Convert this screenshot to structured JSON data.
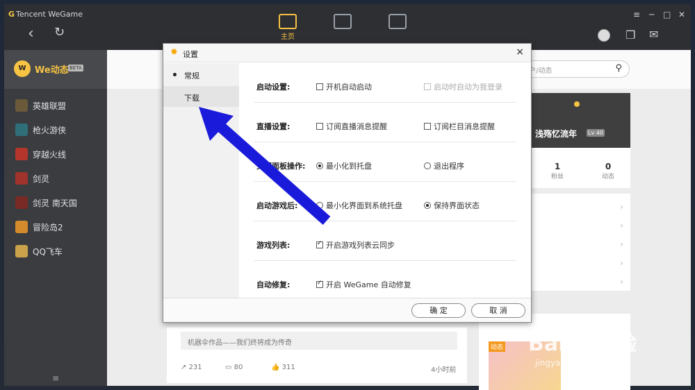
{
  "app": {
    "logo_brand": "G",
    "logo_text": "Tencent WeGame"
  },
  "topnav": {
    "home_label": "主页"
  },
  "sidebar": {
    "brand_icon": "W",
    "brand_name": "We动态",
    "brand_badge": "BETA",
    "games": [
      {
        "label": "英雄联盟",
        "color": "#6b5a3a"
      },
      {
        "label": "枪火游侠",
        "color": "#2f6f7a"
      },
      {
        "label": "穿越火线",
        "color": "#b3352b"
      },
      {
        "label": "剑灵",
        "color": "#a0342c"
      },
      {
        "label": "剑灵 南天国",
        "color": "#7a2a24"
      },
      {
        "label": "冒险岛2",
        "color": "#d28a2c"
      },
      {
        "label": "QQ飞车",
        "color": "#c9a24b"
      }
    ],
    "menu_icon": "≡"
  },
  "search": {
    "placeholder": "户/动态"
  },
  "profile": {
    "name": "浅殇忆流年",
    "level": "Lv 40"
  },
  "stats": [
    {
      "num": "1",
      "label": "粉丝"
    },
    {
      "num": "0",
      "label": "动态"
    }
  ],
  "feed": {
    "quote": "机器伞作品——我们终将成为传奇",
    "share_count": "231",
    "comment_count": "80",
    "like_count": "311",
    "time": "4小时前",
    "ad_tag": "动态"
  },
  "dialog": {
    "title": "设置",
    "close": "×",
    "nav": [
      {
        "label": "常规"
      },
      {
        "label": "下载"
      }
    ],
    "rows": [
      {
        "label": "启动设置:",
        "opt1": "开机自动启动",
        "opt2": "启动时自动为我登录"
      },
      {
        "label": "直播设置:",
        "opt1": "订阅直播消息提醒",
        "opt2": "订阅栏目消息提醒"
      },
      {
        "label": "关闭面板操作:",
        "opt1": "最小化到托盘",
        "opt2": "退出程序"
      },
      {
        "label": "启动游戏后:",
        "opt1": "最小化界面到系统托盘",
        "opt2": "保持界面状态"
      },
      {
        "label": "游戏列表:",
        "opt1": "开启游戏列表云同步"
      },
      {
        "label": "自动修复:",
        "opt1": "开启 WeGame 自动修复"
      }
    ],
    "ok": "确 定",
    "cancel": "取 消"
  },
  "watermark": {
    "text": "Baidu经验",
    "url": "jingyan.baidu.com"
  },
  "colors": {
    "accent": "#f6c343",
    "annotation_arrow": "#1a1adb"
  }
}
